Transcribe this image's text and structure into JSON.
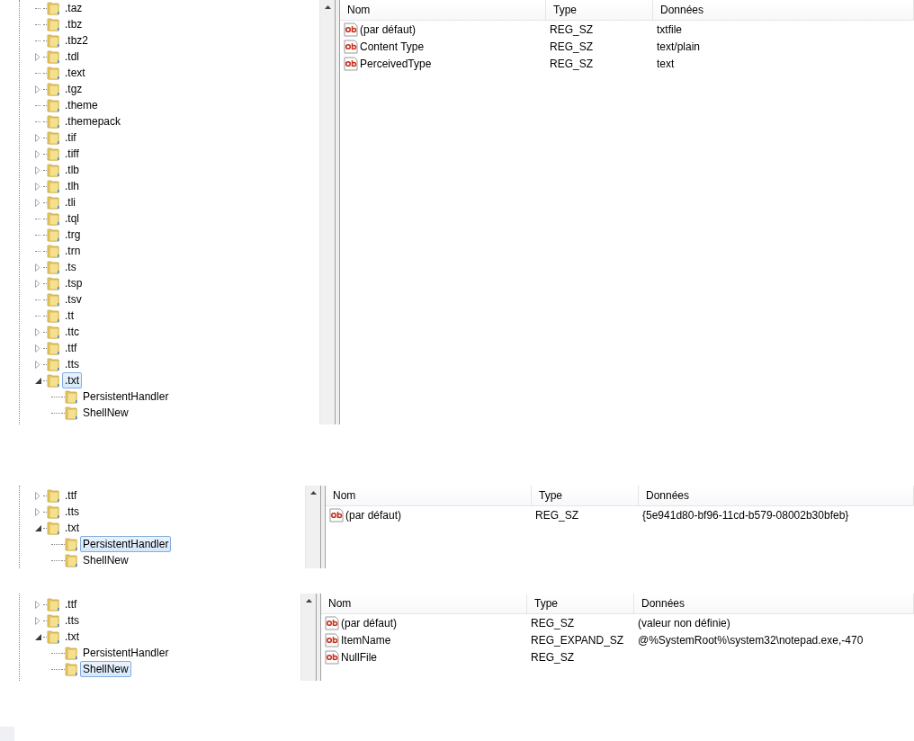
{
  "panels": [
    {
      "tree": [
        {
          "label": ".taz",
          "has_children": false,
          "expanded": false,
          "selected": false
        },
        {
          "label": ".tbz",
          "has_children": false,
          "expanded": false,
          "selected": false
        },
        {
          "label": ".tbz2",
          "has_children": false,
          "expanded": false,
          "selected": false
        },
        {
          "label": ".tdl",
          "has_children": true,
          "expanded": false,
          "selected": false
        },
        {
          "label": ".text",
          "has_children": false,
          "expanded": false,
          "selected": false
        },
        {
          "label": ".tgz",
          "has_children": true,
          "expanded": false,
          "selected": false
        },
        {
          "label": ".theme",
          "has_children": false,
          "expanded": false,
          "selected": false
        },
        {
          "label": ".themepack",
          "has_children": false,
          "expanded": false,
          "selected": false
        },
        {
          "label": ".tif",
          "has_children": true,
          "expanded": false,
          "selected": false
        },
        {
          "label": ".tiff",
          "has_children": true,
          "expanded": false,
          "selected": false
        },
        {
          "label": ".tlb",
          "has_children": true,
          "expanded": false,
          "selected": false
        },
        {
          "label": ".tlh",
          "has_children": true,
          "expanded": false,
          "selected": false
        },
        {
          "label": ".tli",
          "has_children": true,
          "expanded": false,
          "selected": false
        },
        {
          "label": ".tql",
          "has_children": false,
          "expanded": false,
          "selected": false
        },
        {
          "label": ".trg",
          "has_children": false,
          "expanded": false,
          "selected": false
        },
        {
          "label": ".trn",
          "has_children": false,
          "expanded": false,
          "selected": false
        },
        {
          "label": ".ts",
          "has_children": true,
          "expanded": false,
          "selected": false
        },
        {
          "label": ".tsp",
          "has_children": true,
          "expanded": false,
          "selected": false
        },
        {
          "label": ".tsv",
          "has_children": false,
          "expanded": false,
          "selected": false
        },
        {
          "label": ".tt",
          "has_children": false,
          "expanded": false,
          "selected": false
        },
        {
          "label": ".ttc",
          "has_children": true,
          "expanded": false,
          "selected": false
        },
        {
          "label": ".ttf",
          "has_children": true,
          "expanded": false,
          "selected": false
        },
        {
          "label": ".tts",
          "has_children": true,
          "expanded": false,
          "selected": false
        },
        {
          "label": ".txt",
          "has_children": true,
          "expanded": true,
          "selected": true,
          "children": [
            {
              "label": "PersistentHandler",
              "has_children": false,
              "expanded": false,
              "selected": false
            },
            {
              "label": "ShellNew",
              "has_children": false,
              "expanded": false,
              "selected": false
            }
          ]
        }
      ],
      "columns": [
        "Nom",
        "Type",
        "Données"
      ],
      "rows": [
        {
          "name": "(par défaut)",
          "type": "REG_SZ",
          "data": "txtfile"
        },
        {
          "name": "Content Type",
          "type": "REG_SZ",
          "data": "text/plain"
        },
        {
          "name": "PerceivedType",
          "type": "REG_SZ",
          "data": "text"
        }
      ]
    },
    {
      "tree": [
        {
          "label": ".ttf",
          "has_children": true,
          "expanded": false,
          "selected": false
        },
        {
          "label": ".tts",
          "has_children": true,
          "expanded": false,
          "selected": false
        },
        {
          "label": ".txt",
          "has_children": true,
          "expanded": true,
          "selected": false,
          "children": [
            {
              "label": "PersistentHandler",
              "has_children": false,
              "expanded": false,
              "selected": true
            },
            {
              "label": "ShellNew",
              "has_children": false,
              "expanded": false,
              "selected": false
            }
          ]
        }
      ],
      "columns": [
        "Nom",
        "Type",
        "Données"
      ],
      "rows": [
        {
          "name": "(par défaut)",
          "type": "REG_SZ",
          "data": "{5e941d80-bf96-11cd-b579-08002b30bfeb}"
        }
      ]
    },
    {
      "tree": [
        {
          "label": ".ttf",
          "has_children": true,
          "expanded": false,
          "selected": false
        },
        {
          "label": ".tts",
          "has_children": true,
          "expanded": false,
          "selected": false
        },
        {
          "label": ".txt",
          "has_children": true,
          "expanded": true,
          "selected": false,
          "children": [
            {
              "label": "PersistentHandler",
              "has_children": false,
              "expanded": false,
              "selected": false
            },
            {
              "label": "ShellNew",
              "has_children": false,
              "expanded": false,
              "selected": true
            }
          ]
        }
      ],
      "columns": [
        "Nom",
        "Type",
        "Données"
      ],
      "rows": [
        {
          "name": "(par défaut)",
          "type": "REG_SZ",
          "data": "(valeur non définie)"
        },
        {
          "name": "ItemName",
          "type": "REG_EXPAND_SZ",
          "data": "@%SystemRoot%\\system32\\notepad.exe,-470"
        },
        {
          "name": "NullFile",
          "type": "REG_SZ"
        }
      ]
    }
  ]
}
